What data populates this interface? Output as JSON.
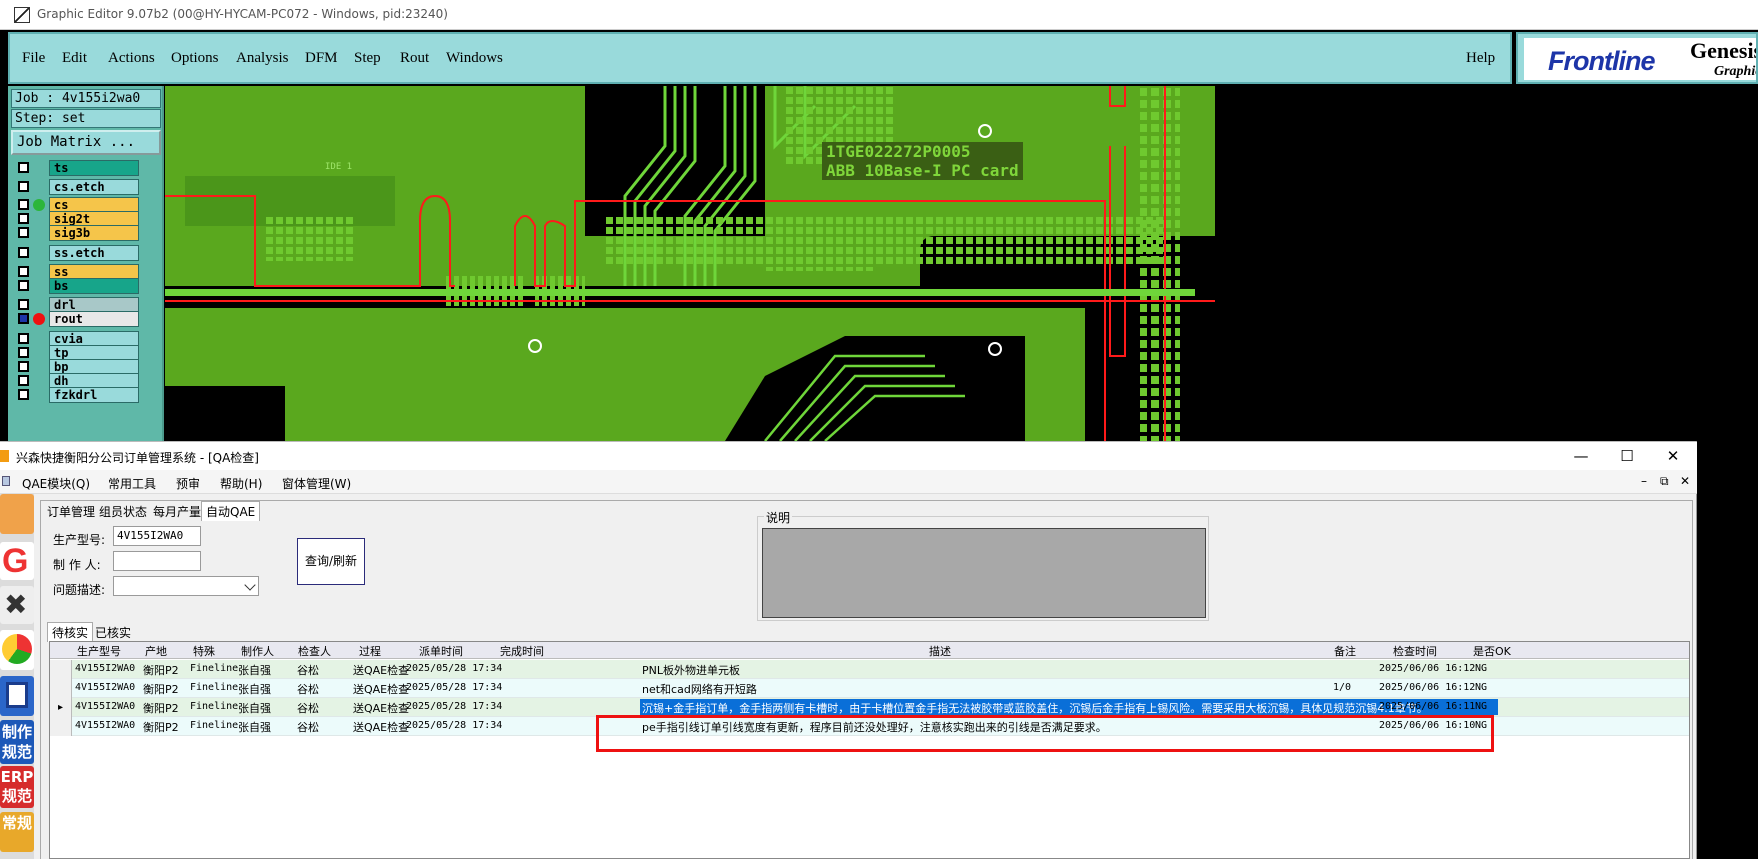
{
  "genesis": {
    "window_title": "Graphic Editor 9.07b2 (00@HY-HYCAM-PC072 - Windows, pid:23240)",
    "menu": [
      {
        "label": "File"
      },
      {
        "label": "Edit"
      },
      {
        "label": "Actions"
      },
      {
        "label": "Options"
      },
      {
        "label": "Analysis"
      },
      {
        "label": "DFM"
      },
      {
        "label": "Step"
      },
      {
        "label": "Rout"
      },
      {
        "label": "Windows"
      }
    ],
    "help_label": "Help",
    "logo": {
      "frontline": "Frontline",
      "genesis": "Genesis",
      "graphic": "Graphic"
    },
    "job_label": "Job : 4v155i2wa0",
    "step_label": "Step: set",
    "job_matrix_label": "Job Matrix ...",
    "layers": [
      {
        "name": "ts",
        "color": "#17a58a",
        "dot": null,
        "checked": false
      },
      {
        "name": "cs.etch",
        "color": "#99dadb",
        "dot": null,
        "checked": false
      },
      {
        "name": "cs",
        "color": "#f5c54a",
        "dot": "#2cb63a",
        "checked": false
      },
      {
        "name": "sig2t",
        "color": "#f5c54a",
        "dot": null,
        "checked": false
      },
      {
        "name": "sig3b",
        "color": "#f5c54a",
        "dot": null,
        "checked": false
      },
      {
        "name": "ss.etch",
        "color": "#99dadb",
        "dot": null,
        "checked": false
      },
      {
        "name": "ss",
        "color": "#f5c54a",
        "dot": null,
        "checked": false
      },
      {
        "name": "bs",
        "color": "#17a58a",
        "dot": null,
        "checked": false
      },
      {
        "name": "drl",
        "color": "#a8c8c8",
        "dot": null,
        "checked": false
      },
      {
        "name": "rout",
        "color": "#e8e8e8",
        "dot": "#e11",
        "checked": true
      },
      {
        "name": "cvia",
        "color": "#99dadb",
        "dot": null,
        "checked": false
      },
      {
        "name": "tp",
        "color": "#99dadb",
        "dot": null,
        "checked": false
      },
      {
        "name": "bp",
        "color": "#99dadb",
        "dot": null,
        "checked": false
      },
      {
        "name": "dh",
        "color": "#99dadb",
        "dot": null,
        "checked": false
      },
      {
        "name": "fzkdrl",
        "color": "#99dadb",
        "dot": null,
        "checked": false
      }
    ],
    "pcb_text_line1": "1TGE022272P0005",
    "pcb_text_line2": "ABB 10Base-I PC card",
    "pcb_small_text": "IDE 1"
  },
  "qa": {
    "window_title": "兴森快捷衡阳分公司订单管理系统 - [QA检查]",
    "menu": [
      {
        "label": "QAE模块(Q)"
      },
      {
        "label": "常用工具"
      },
      {
        "label": "预审"
      },
      {
        "label": "帮助(H)"
      },
      {
        "label": "窗体管理(W)"
      }
    ],
    "tabs": [
      {
        "label": "订单管理"
      },
      {
        "label": "组员状态"
      },
      {
        "label": "每月产量"
      },
      {
        "label": "自动QAE"
      }
    ],
    "form": {
      "model_label": "生产型号:",
      "model_value": "4V155I2WA0",
      "maker_label": "制 作 人:",
      "maker_value": "",
      "issue_label": "问题描述:",
      "issue_value": "",
      "query_button": "查询/刷新",
      "desc_legend": "说明"
    },
    "sub_tabs": [
      {
        "label": "待核实"
      },
      {
        "label": "已核实"
      }
    ],
    "columns": [
      "生产型号",
      "产地",
      "特殊",
      "制作人",
      "检查人",
      "过程",
      "派单时间",
      "完成时间",
      "描述",
      "备注",
      "检查时间",
      "是否OK"
    ],
    "rows": [
      {
        "model": "4V155I2WA0",
        "place": "衡阳P2",
        "special": "Fineline",
        "maker": "张自强",
        "checker": "谷松",
        "process": "送QAE检查",
        "dispatch": "2025/05/28 17:34",
        "done": "",
        "desc": "PNL板外物进单元板",
        "note": "",
        "check_time": "2025/06/06 16:12",
        "ok": "NG"
      },
      {
        "model": "4V155I2WA0",
        "place": "衡阳P2",
        "special": "Fineline",
        "maker": "张自强",
        "checker": "谷松",
        "process": "送QAE检查",
        "dispatch": "2025/05/28 17:34",
        "done": "",
        "desc": "net和cad网络有开短路",
        "note": "1/0",
        "check_time": "2025/06/06 16:12",
        "ok": "NG"
      },
      {
        "model": "4V155I2WA0",
        "place": "衡阳P2",
        "special": "Fineline",
        "maker": "张自强",
        "checker": "谷松",
        "process": "送QAE检查",
        "dispatch": "2025/05/28 17:34",
        "done": "",
        "desc": "沉锡+金手指订单，金手指两侧有卡槽时，由于卡槽位置金手指无法被胶带或蓝胶盖住，沉锡后金手指有上锡风险。需要采用大板沉锡，具体见规范沉锡4.1章节。",
        "note": "",
        "check_time": "2025/06/06 16:11",
        "ok": "NG"
      },
      {
        "model": "4V155I2WA0",
        "place": "衡阳P2",
        "special": "Fineline",
        "maker": "张自强",
        "checker": "谷松",
        "process": "送QAE检查",
        "dispatch": "2025/05/28 17:34",
        "done": "",
        "desc": "pe手指引线订单引线宽度有更新，程序目前还没处理好，注意核实跑出来的引线是否满足要求。",
        "note": "",
        "check_time": "2025/06/06 16:10",
        "ok": "NG"
      }
    ],
    "left_strip": [
      {
        "label": "制作\n规范"
      },
      {
        "label": "ERP\n规范"
      },
      {
        "label": "常规"
      }
    ]
  }
}
